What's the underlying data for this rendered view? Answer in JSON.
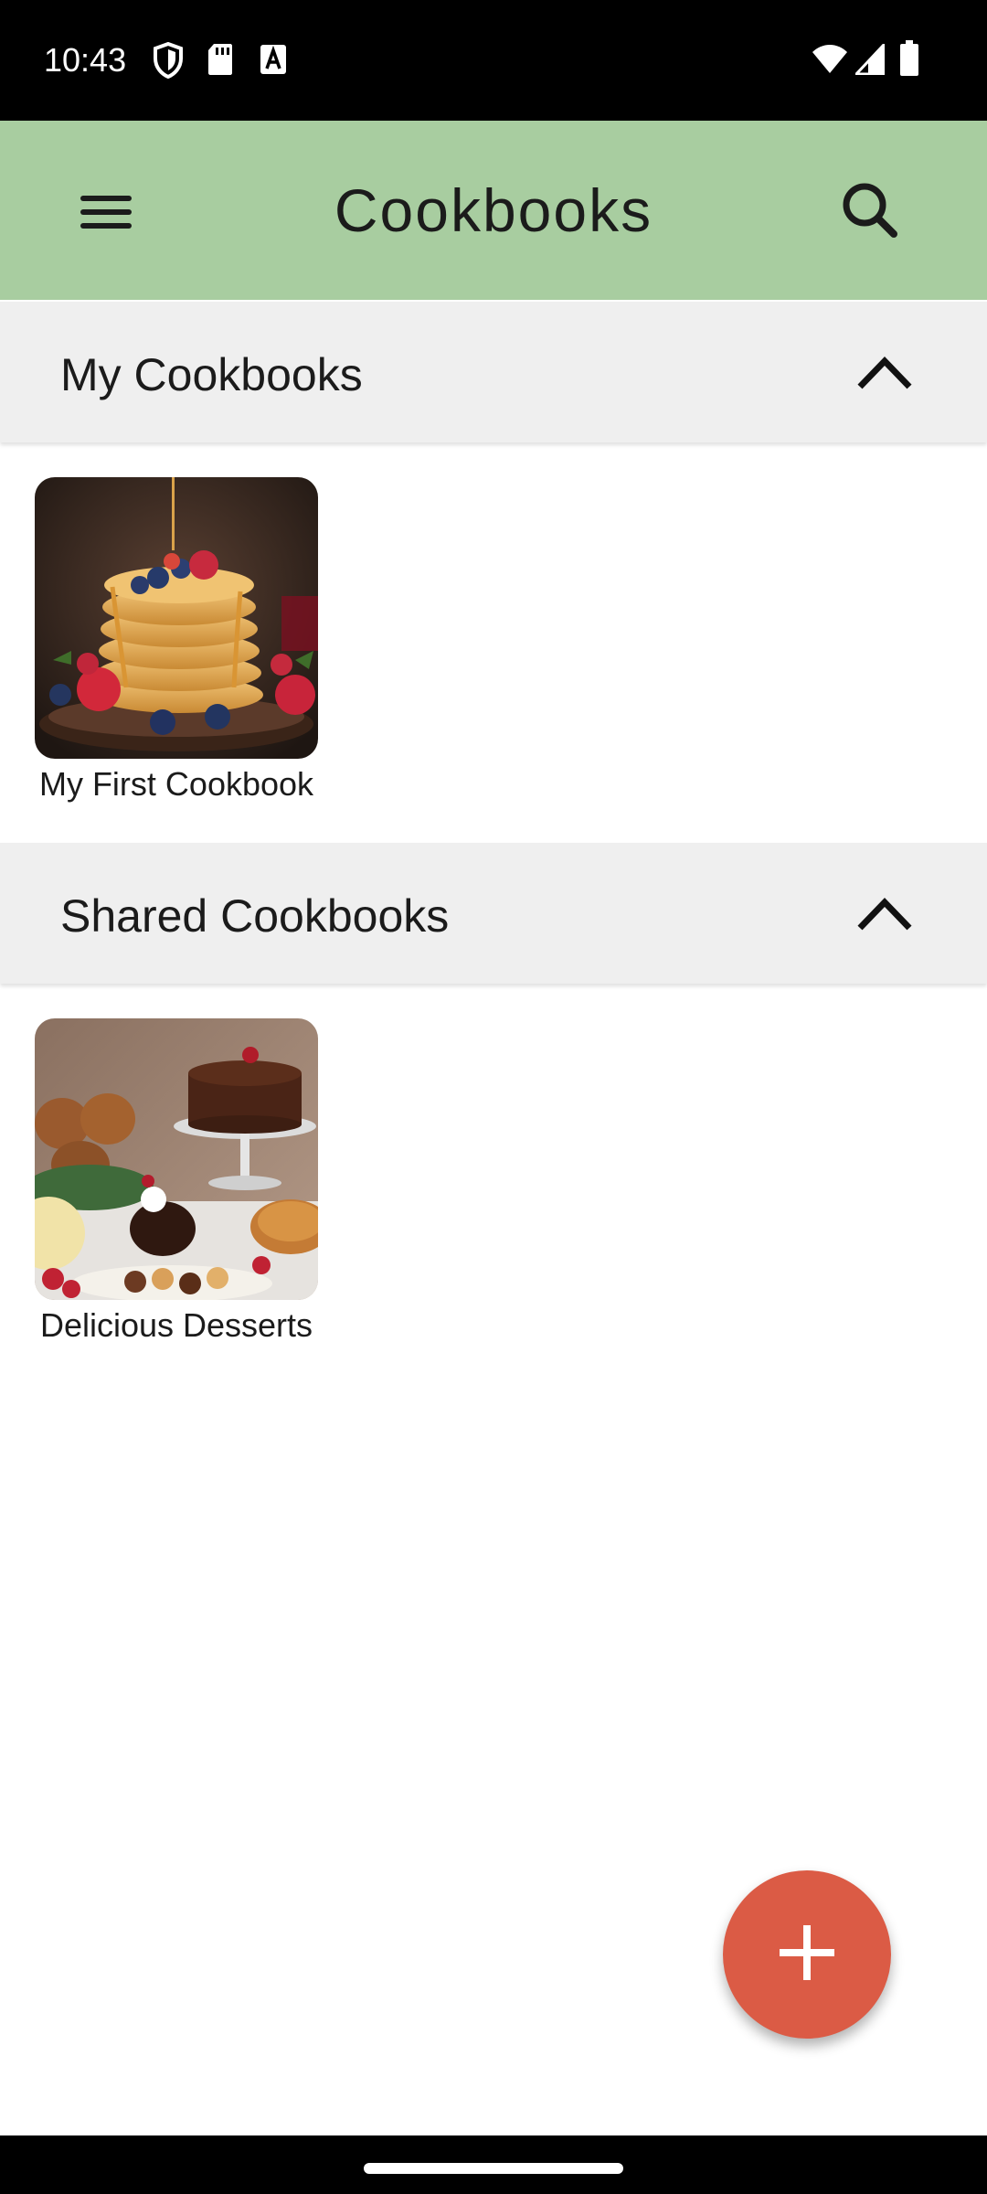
{
  "status_bar": {
    "time": "10:43",
    "icons": [
      "shield-icon",
      "sd-card-icon",
      "font-a-icon",
      "wifi-icon",
      "signal-icon",
      "battery-icon"
    ]
  },
  "app_bar": {
    "title": "Cookbooks",
    "menu_icon": "menu-icon",
    "search_icon": "search-icon",
    "background": "#a8cda0"
  },
  "sections": [
    {
      "title": "My Cookbooks",
      "expanded": true,
      "cookbooks": [
        {
          "name": "My First Cookbook",
          "image": "pancake-stack-with-berries"
        }
      ]
    },
    {
      "title": "Shared Cookbooks",
      "expanded": true,
      "cookbooks": [
        {
          "name": "Delicious Desserts",
          "image": "dessert-table-with-chocolate-cake"
        }
      ]
    }
  ],
  "fab": {
    "icon": "plus-icon",
    "color": "#db5b45"
  }
}
